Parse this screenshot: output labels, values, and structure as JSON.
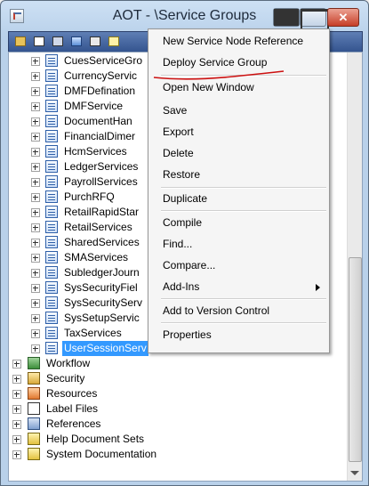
{
  "window": {
    "title": "AOT - \\Service Groups"
  },
  "colors": {
    "selection": "#3399ff",
    "toolbar": "#3f5f9a",
    "annotation": "#cc1010"
  },
  "toolbar": {
    "icons": [
      "open-icon",
      "properties-icon",
      "compile-icon",
      "import-icon",
      "export-icon",
      "new-icon"
    ]
  },
  "tree": {
    "services": [
      "CuesServiceGro",
      "CurrencyServic",
      "DMFDefination",
      "DMFService",
      "DocumentHan",
      "FinancialDimer",
      "HcmServices",
      "LedgerServices",
      "PayrollServices",
      "PurchRFQ",
      "RetailRapidStar",
      "RetailServices",
      "SharedServices",
      "SMAServices",
      "SubledgerJourn",
      "SysSecurityFiel",
      "SysSecurityServ",
      "SysSetupServic",
      "TaxServices",
      "UserSessionServ"
    ],
    "selected_service": "UserSessionServ",
    "top_level": [
      {
        "label": "Workflow",
        "icon": "workflow-icon"
      },
      {
        "label": "Security",
        "icon": "security-icon"
      },
      {
        "label": "Resources",
        "icon": "resources-icon"
      },
      {
        "label": "Label Files",
        "icon": "label-files-icon"
      },
      {
        "label": "References",
        "icon": "references-icon"
      },
      {
        "label": "Help Document Sets",
        "icon": "help-document-sets-icon"
      },
      {
        "label": "System Documentation",
        "icon": "system-documentation-icon"
      }
    ]
  },
  "context_menu": {
    "items": [
      "New Service Node Reference",
      "Deploy Service Group",
      "Open New Window",
      "Save",
      "Export",
      "Delete",
      "Restore",
      "Duplicate",
      "Compile",
      "Find...",
      "Compare...",
      "Add-Ins",
      "Add to Version Control",
      "Properties"
    ]
  }
}
